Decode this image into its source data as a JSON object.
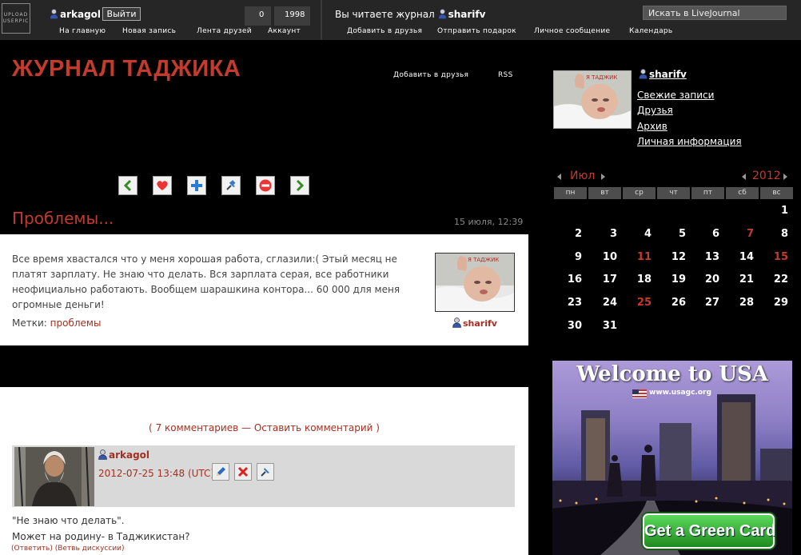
{
  "topbar": {
    "upload_userpic": "UPLOAD USERPIC",
    "username": "arkagol",
    "logout": "Выйти",
    "count_a": "0",
    "count_b": "1998",
    "nav_left": [
      "На главную",
      "Новая запись",
      "Лента друзей",
      "Аккаунт"
    ],
    "reading_prefix": "Вы читаете журнал",
    "reading_user": "sharifv",
    "nav_right": [
      "Добавить в друзья",
      "Отправить подарок",
      "Личное сообщение",
      "Календарь"
    ],
    "search_placeholder": "Искать в LiveJournal"
  },
  "header": {
    "title": "ЖУРНАЛ ТАДЖИКА",
    "add_friend": "Добавить в друзья",
    "rss": "RSS"
  },
  "toolbar_icons": [
    "prev-arrow-icon",
    "heart-icon",
    "plus-icon",
    "pin-icon",
    "minus-icon",
    "next-arrow-icon"
  ],
  "post": {
    "title": "Проблемы...",
    "date": "15 июля, 12:39",
    "text": "Все время хвастался что у меня хорошая работа, сглазили:( Этый месяц не платят зарплату. Не знаю что делать. Вся зарплата серая, все работники неофициально работають. Вообщем шарашкина контора... 60 000 для меня огромные деньги!",
    "tags_label": "Метки:",
    "tag": "проблемы",
    "author": "sharifv"
  },
  "comments": {
    "count_link": "7 комментариев",
    "dash": "—",
    "leave_link": "Оставить комментарий",
    "open_paren": "(",
    "close_paren": ")",
    "author": "arkagol",
    "date": "2012-07-25 13:48 (UTC)",
    "line1": "\"Не знаю что делать\".",
    "line2": "Может на родину- в Таджикистан?",
    "reply": "(Ответить)",
    "thread": "(Ветвь дискуссии)"
  },
  "sidebar": {
    "userpic_caption": "Я ТАДЖИК",
    "user": "sharifv",
    "links": [
      "Свежие записи",
      "Друзья",
      "Архив",
      "Личная информация"
    ]
  },
  "calendar": {
    "month": "Июл",
    "year": "2012",
    "weekdays": [
      "пн",
      "вт",
      "ср",
      "чт",
      "пт",
      "сб",
      "вс"
    ],
    "weeks": [
      [
        "",
        "",
        "",
        "",
        "",
        "",
        "1"
      ],
      [
        "2",
        "3",
        "4",
        "5",
        "6",
        "7",
        "8"
      ],
      [
        "9",
        "10",
        "11",
        "12",
        "13",
        "14",
        "15"
      ],
      [
        "16",
        "17",
        "18",
        "19",
        "20",
        "21",
        "22"
      ],
      [
        "23",
        "24",
        "25",
        "26",
        "27",
        "28",
        "29"
      ],
      [
        "30",
        "31",
        "",
        "",
        "",
        "",
        ""
      ]
    ],
    "highlighted_days": [
      "7",
      "11",
      "15",
      "25"
    ]
  },
  "ad": {
    "title": "Welcome to USA",
    "url": "www.usagc.org",
    "button": "Get a Green Card"
  },
  "colors": {
    "accent": "#c43a2c",
    "topbar": "#262626",
    "background": "#000000"
  }
}
